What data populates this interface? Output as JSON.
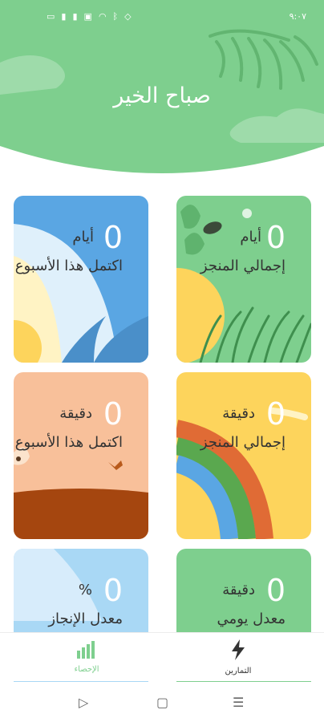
{
  "status_bar": {
    "time": "٩:٠٧",
    "icons": [
      "battery-icon",
      "signal-icon",
      "signal-icon-2",
      "nfc-icon",
      "wifi-icon",
      "bluetooth-icon",
      "vibrate-icon"
    ]
  },
  "header": {
    "greeting": "صباح الخير",
    "color": "#7ecf8e"
  },
  "cards": [
    {
      "id": "total-days",
      "value": "0",
      "unit": "أيام",
      "caption": "إجمالي المنجز",
      "color": "#7ecf8e"
    },
    {
      "id": "week-days",
      "value": "0",
      "unit": "أيام",
      "caption": "اكتمل هذا الأسبوع",
      "color": "#5aa6e3"
    },
    {
      "id": "total-minutes",
      "value": "0",
      "unit": "دقيقة",
      "caption": "إجمالي المنجز",
      "color": "#fdd45c"
    },
    {
      "id": "week-minutes",
      "value": "0",
      "unit": "دقيقة",
      "caption": "اكتمل هذا الأسبوع",
      "color": "#f8c09a"
    },
    {
      "id": "daily-average",
      "value": "0",
      "unit": "دقيقة",
      "caption": "معدل يومي",
      "color": "#7ecf8e"
    },
    {
      "id": "completion-rate",
      "value": "0",
      "unit": "%",
      "caption": "معدل الإنجاز",
      "color": "#a9d8f5"
    }
  ],
  "bottom_nav": {
    "items": [
      {
        "label": "الإحصاء",
        "icon": "bar-chart-icon",
        "active": true
      },
      {
        "label": "التمارين",
        "icon": "lightning-icon",
        "active": false
      }
    ],
    "active_color": "#7ecf8e"
  },
  "system_nav": [
    "back-icon",
    "home-icon",
    "recents-icon"
  ]
}
